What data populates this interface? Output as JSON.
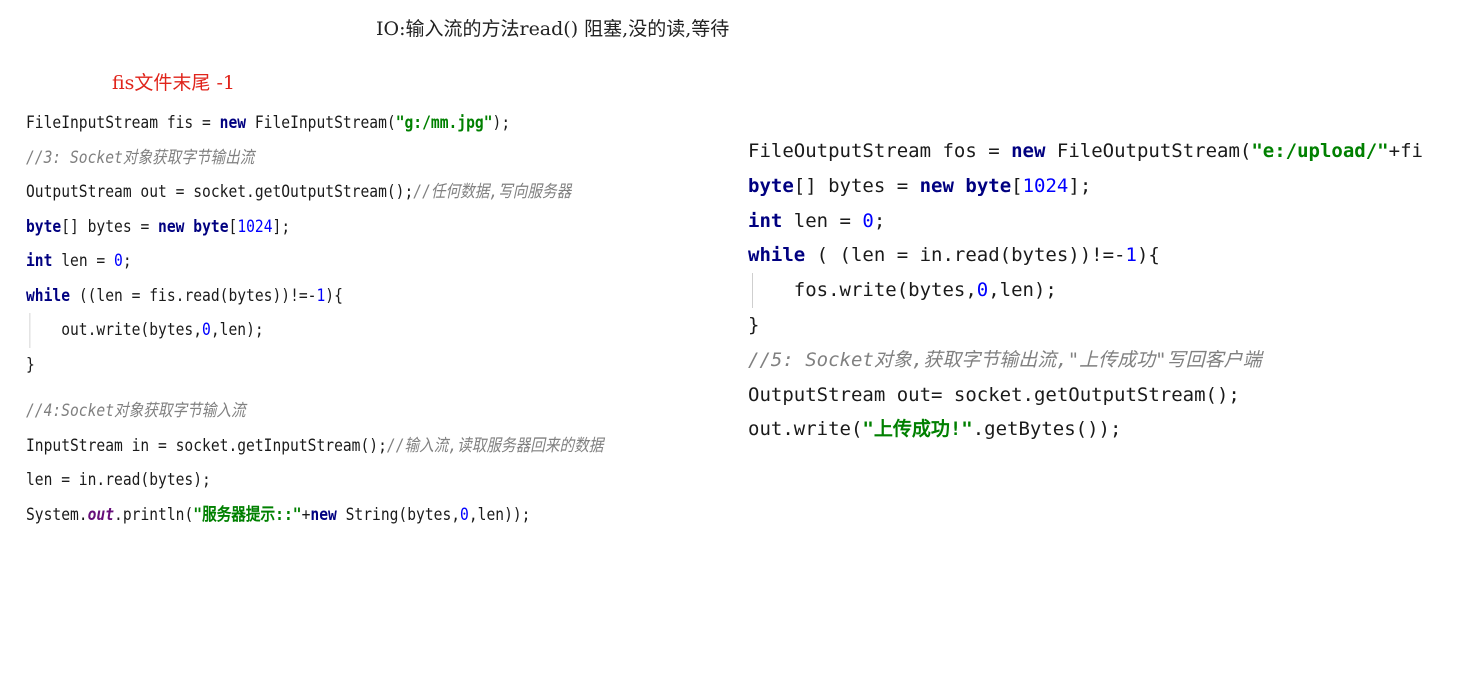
{
  "heading": "IO:输入流的方法read() 阻塞,没的读,等待",
  "note": "fis文件末尾 -1",
  "left_code": [
    {
      "indent": false,
      "segments": [
        {
          "t": "FileInputStream fis = ",
          "c": "plain"
        },
        {
          "t": "new",
          "c": "kw"
        },
        {
          "t": " FileInputStream(",
          "c": "plain"
        },
        {
          "t": "\"g:/mm.jpg\"",
          "c": "str"
        },
        {
          "t": ");",
          "c": "plain"
        }
      ]
    },
    {
      "indent": false,
      "segments": [
        {
          "t": "//3: Socket对象获取字节输出流",
          "c": "cm"
        }
      ]
    },
    {
      "indent": false,
      "segments": [
        {
          "t": "OutputStream out = socket.getOutputStream();",
          "c": "plain"
        },
        {
          "t": "//任何数据,写向服务器",
          "c": "cm"
        }
      ]
    },
    {
      "indent": false,
      "segments": [
        {
          "t": "byte",
          "c": "kw"
        },
        {
          "t": "[] bytes = ",
          "c": "plain"
        },
        {
          "t": "new",
          "c": "kw"
        },
        {
          "t": " ",
          "c": "plain"
        },
        {
          "t": "byte",
          "c": "kw"
        },
        {
          "t": "[",
          "c": "plain"
        },
        {
          "t": "1024",
          "c": "num"
        },
        {
          "t": "];",
          "c": "plain"
        }
      ]
    },
    {
      "indent": false,
      "segments": [
        {
          "t": "int",
          "c": "kw"
        },
        {
          "t": " len = ",
          "c": "plain"
        },
        {
          "t": "0",
          "c": "num"
        },
        {
          "t": ";",
          "c": "plain"
        }
      ]
    },
    {
      "indent": false,
      "segments": [
        {
          "t": "while",
          "c": "kw"
        },
        {
          "t": " ((len = fis.read(bytes))!=-",
          "c": "plain"
        },
        {
          "t": "1",
          "c": "num"
        },
        {
          "t": "){",
          "c": "plain"
        }
      ]
    },
    {
      "indent": true,
      "segments": [
        {
          "t": "    out.write(bytes,",
          "c": "plain"
        },
        {
          "t": "0",
          "c": "num"
        },
        {
          "t": ",len);",
          "c": "plain"
        }
      ]
    },
    {
      "indent": false,
      "segments": [
        {
          "t": "}",
          "c": "plain"
        }
      ]
    },
    {
      "indent": false,
      "segments": [
        {
          "t": "//4:Socket对象获取字节输入流",
          "c": "cm"
        }
      ]
    },
    {
      "indent": false,
      "segments": [
        {
          "t": "InputStream in = socket.getInputStream();",
          "c": "plain"
        },
        {
          "t": "//输入流,读取服务器回来的数据",
          "c": "cm"
        }
      ]
    },
    {
      "indent": false,
      "segments": [
        {
          "t": "len = in.read(bytes);",
          "c": "plain"
        }
      ]
    },
    {
      "indent": false,
      "segments": [
        {
          "t": "System.",
          "c": "plain"
        },
        {
          "t": "out",
          "c": "field"
        },
        {
          "t": ".println(",
          "c": "plain"
        },
        {
          "t": "\"服务器提示::\"",
          "c": "str"
        },
        {
          "t": "+",
          "c": "plain"
        },
        {
          "t": "new",
          "c": "kw"
        },
        {
          "t": " String(bytes,",
          "c": "plain"
        },
        {
          "t": "0",
          "c": "num"
        },
        {
          "t": ",len));",
          "c": "plain"
        }
      ]
    }
  ],
  "right_code": [
    {
      "indent": false,
      "segments": [
        {
          "t": "FileOutputStream fos = ",
          "c": "plain"
        },
        {
          "t": "new",
          "c": "kw"
        },
        {
          "t": " FileOutputStream(",
          "c": "plain"
        },
        {
          "t": "\"e:/upload/\"",
          "c": "str"
        },
        {
          "t": "+fi",
          "c": "plain"
        }
      ]
    },
    {
      "indent": false,
      "segments": [
        {
          "t": "byte",
          "c": "kw"
        },
        {
          "t": "[] bytes = ",
          "c": "plain"
        },
        {
          "t": "new",
          "c": "kw"
        },
        {
          "t": " ",
          "c": "plain"
        },
        {
          "t": "byte",
          "c": "kw"
        },
        {
          "t": "[",
          "c": "plain"
        },
        {
          "t": "1024",
          "c": "num"
        },
        {
          "t": "];",
          "c": "plain"
        }
      ]
    },
    {
      "indent": false,
      "segments": [
        {
          "t": "int",
          "c": "kw"
        },
        {
          "t": " len = ",
          "c": "plain"
        },
        {
          "t": "0",
          "c": "num"
        },
        {
          "t": ";",
          "c": "plain"
        }
      ]
    },
    {
      "indent": false,
      "segments": [
        {
          "t": "while",
          "c": "kw"
        },
        {
          "t": " ( (len = in.read(bytes))!=-",
          "c": "plain"
        },
        {
          "t": "1",
          "c": "num"
        },
        {
          "t": "){",
          "c": "plain"
        }
      ]
    },
    {
      "indent": true,
      "segments": [
        {
          "t": "    fos.write(bytes,",
          "c": "plain"
        },
        {
          "t": "0",
          "c": "num"
        },
        {
          "t": ",len);",
          "c": "plain"
        }
      ]
    },
    {
      "indent": false,
      "segments": [
        {
          "t": "}",
          "c": "plain"
        }
      ]
    },
    {
      "indent": false,
      "segments": [
        {
          "t": "//5: Socket对象,获取字节输出流,\"上传成功\"写回客户端",
          "c": "cm"
        }
      ]
    },
    {
      "indent": false,
      "segments": [
        {
          "t": "OutputStream out= socket.getOutputStream();",
          "c": "plain"
        }
      ]
    },
    {
      "indent": false,
      "segments": [
        {
          "t": "out.write(",
          "c": "plain"
        },
        {
          "t": "\"上传成功!\"",
          "c": "str"
        },
        {
          "t": ".getBytes());",
          "c": "plain"
        }
      ]
    }
  ]
}
